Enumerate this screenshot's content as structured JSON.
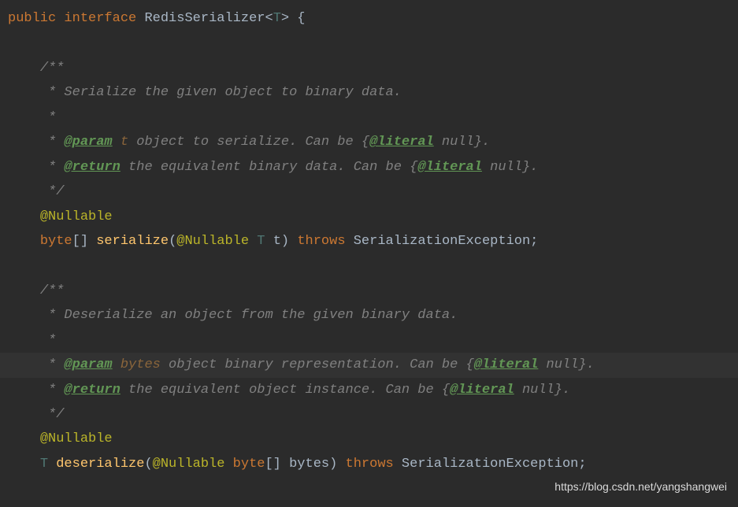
{
  "lines": [
    {
      "cls": "code-line",
      "tokens": [
        {
          "c": "keyword",
          "t": "public"
        },
        {
          "c": "punct",
          "t": " "
        },
        {
          "c": "keyword",
          "t": "interface"
        },
        {
          "c": "punct",
          "t": " "
        },
        {
          "c": "class-name",
          "t": "RedisSerializer<"
        },
        {
          "c": "type-param",
          "t": "T"
        },
        {
          "c": "class-name",
          "t": "> {"
        }
      ]
    },
    {
      "cls": "code-line",
      "tokens": [
        {
          "c": "punct",
          "t": " "
        }
      ]
    },
    {
      "cls": "code-line",
      "tokens": [
        {
          "c": "punct",
          "t": "    "
        },
        {
          "c": "comment",
          "t": "/**"
        }
      ]
    },
    {
      "cls": "code-line",
      "tokens": [
        {
          "c": "punct",
          "t": "    "
        },
        {
          "c": "comment",
          "t": " * Serialize the given object to binary data."
        }
      ]
    },
    {
      "cls": "code-line",
      "tokens": [
        {
          "c": "punct",
          "t": "    "
        },
        {
          "c": "comment",
          "t": " *"
        }
      ]
    },
    {
      "cls": "code-line",
      "tokens": [
        {
          "c": "punct",
          "t": "    "
        },
        {
          "c": "comment",
          "t": " * "
        },
        {
          "c": "doc-tag",
          "t": "@param"
        },
        {
          "c": "comment",
          "t": " "
        },
        {
          "c": "doc-param-name",
          "t": "t"
        },
        {
          "c": "comment",
          "t": " object to serialize. Can be {"
        },
        {
          "c": "doc-tag",
          "t": "@literal"
        },
        {
          "c": "comment",
          "t": " null}."
        }
      ]
    },
    {
      "cls": "code-line",
      "tokens": [
        {
          "c": "punct",
          "t": "    "
        },
        {
          "c": "comment",
          "t": " * "
        },
        {
          "c": "doc-tag",
          "t": "@return"
        },
        {
          "c": "comment",
          "t": " the equivalent binary data. Can be {"
        },
        {
          "c": "doc-tag",
          "t": "@literal"
        },
        {
          "c": "comment",
          "t": " null}."
        }
      ]
    },
    {
      "cls": "code-line",
      "tokens": [
        {
          "c": "punct",
          "t": "    "
        },
        {
          "c": "comment",
          "t": " */"
        }
      ]
    },
    {
      "cls": "code-line",
      "tokens": [
        {
          "c": "punct",
          "t": "    "
        },
        {
          "c": "annotation",
          "t": "@Nullable"
        }
      ]
    },
    {
      "cls": "code-line",
      "tokens": [
        {
          "c": "punct",
          "t": "    "
        },
        {
          "c": "keyword",
          "t": "byte"
        },
        {
          "c": "punct",
          "t": "[] "
        },
        {
          "c": "method-name",
          "t": "serialize"
        },
        {
          "c": "punct",
          "t": "("
        },
        {
          "c": "annotation",
          "t": "@Nullable"
        },
        {
          "c": "punct",
          "t": " "
        },
        {
          "c": "type-param",
          "t": "T"
        },
        {
          "c": "punct",
          "t": " t) "
        },
        {
          "c": "keyword",
          "t": "throws"
        },
        {
          "c": "punct",
          "t": " SerializationException;"
        }
      ]
    },
    {
      "cls": "code-line",
      "tokens": [
        {
          "c": "punct",
          "t": " "
        }
      ]
    },
    {
      "cls": "code-line",
      "tokens": [
        {
          "c": "punct",
          "t": "    "
        },
        {
          "c": "comment",
          "t": "/**"
        }
      ]
    },
    {
      "cls": "code-line",
      "tokens": [
        {
          "c": "punct",
          "t": "    "
        },
        {
          "c": "comment",
          "t": " * Deserialize an object from the given binary data."
        }
      ]
    },
    {
      "cls": "code-line",
      "tokens": [
        {
          "c": "punct",
          "t": "    "
        },
        {
          "c": "comment",
          "t": " *"
        }
      ]
    },
    {
      "cls": "code-line highlighted-line",
      "tokens": [
        {
          "c": "punct",
          "t": "    "
        },
        {
          "c": "comment",
          "t": " * "
        },
        {
          "c": "doc-tag",
          "t": "@param"
        },
        {
          "c": "comment",
          "t": " "
        },
        {
          "c": "doc-param-name",
          "t": "bytes"
        },
        {
          "c": "comment",
          "t": " object binary representation. Can be {"
        },
        {
          "c": "doc-tag",
          "t": "@lit"
        },
        {
          "c": "doc-tag",
          "t": "eral"
        },
        {
          "c": "comment",
          "t": " null}."
        }
      ]
    },
    {
      "cls": "code-line",
      "tokens": [
        {
          "c": "punct",
          "t": "    "
        },
        {
          "c": "comment",
          "t": " * "
        },
        {
          "c": "doc-tag",
          "t": "@return"
        },
        {
          "c": "comment",
          "t": " the equivalent object instance. Can be {"
        },
        {
          "c": "doc-tag",
          "t": "@literal"
        },
        {
          "c": "comment",
          "t": " null}."
        }
      ]
    },
    {
      "cls": "code-line",
      "tokens": [
        {
          "c": "punct",
          "t": "    "
        },
        {
          "c": "comment",
          "t": " */"
        }
      ]
    },
    {
      "cls": "code-line",
      "tokens": [
        {
          "c": "punct",
          "t": "    "
        },
        {
          "c": "annotation",
          "t": "@Nullable"
        }
      ]
    },
    {
      "cls": "code-line",
      "tokens": [
        {
          "c": "punct",
          "t": "    "
        },
        {
          "c": "type-param",
          "t": "T"
        },
        {
          "c": "punct",
          "t": " "
        },
        {
          "c": "method-name",
          "t": "deserialize"
        },
        {
          "c": "punct",
          "t": "("
        },
        {
          "c": "annotation",
          "t": "@Nullable"
        },
        {
          "c": "punct",
          "t": " "
        },
        {
          "c": "keyword",
          "t": "byte"
        },
        {
          "c": "punct",
          "t": "[] bytes) "
        },
        {
          "c": "keyword",
          "t": "throws"
        },
        {
          "c": "punct",
          "t": " SerializationException;"
        }
      ]
    }
  ],
  "watermark": "https://blog.csdn.net/yangshangwei"
}
